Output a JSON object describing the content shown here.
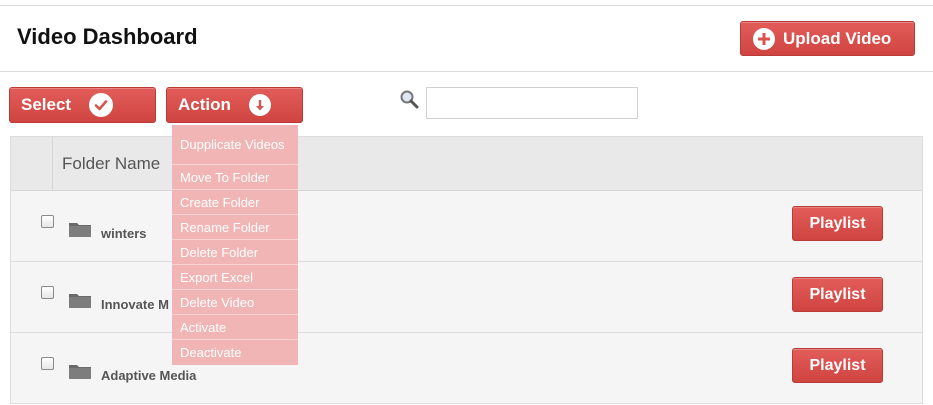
{
  "header": {
    "title": "Video Dashboard",
    "upload_label": "Upload Video"
  },
  "toolbar": {
    "select_label": "Select",
    "action_label": "Action",
    "search_value": "",
    "search_placeholder": ""
  },
  "action_menu": {
    "items": [
      "Dupplicate Videos",
      "Move To Folder",
      "Create Folder",
      "Rename Folder",
      "Delete Folder",
      "Export Excel",
      "Delete Video",
      "Activate",
      "Deactivate"
    ]
  },
  "table": {
    "columns": [
      "Folder Name"
    ],
    "rows": [
      {
        "name": "winters",
        "button": "Playlist"
      },
      {
        "name": "Innovate M",
        "button": "Playlist"
      },
      {
        "name": "Adaptive Media",
        "button": "Playlist"
      }
    ]
  },
  "colors": {
    "accent": "#d9534f",
    "menu_bg": "#f2b5b5"
  },
  "icons": [
    "plus-circle-icon",
    "check-circle-icon",
    "down-arrow-circle-icon",
    "search-icon",
    "folder-icon",
    "checkbox"
  ]
}
